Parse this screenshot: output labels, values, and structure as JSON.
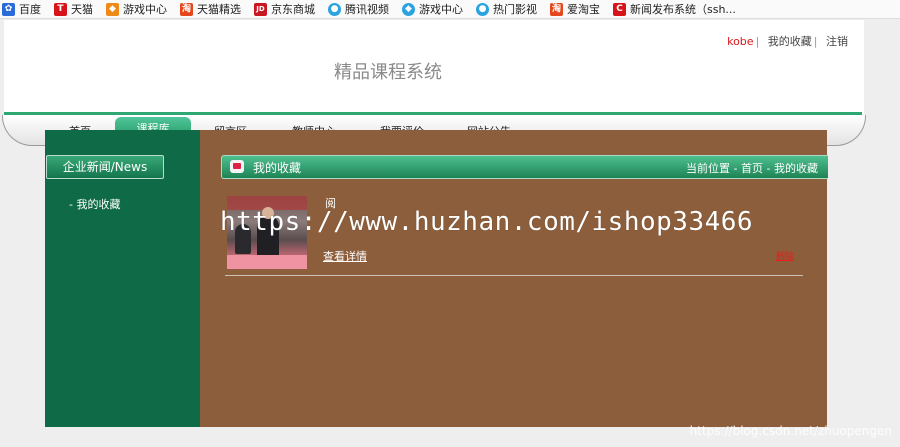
{
  "bookmarks": [
    {
      "label": "百度",
      "icon": "baidu-paw-icon",
      "color": "#2b6ad9"
    },
    {
      "label": "天猫",
      "icon": "tmall-icon",
      "color": "#d7141a"
    },
    {
      "label": "游戏中心",
      "icon": "game-center-icon",
      "color": "#ef8a17"
    },
    {
      "label": "天猫精选",
      "icon": "tmall-select-icon",
      "color": "#e5461c"
    },
    {
      "label": "京东商城",
      "icon": "jd-icon",
      "color": "#c81623"
    },
    {
      "label": "腾讯视频",
      "icon": "tencent-video-icon",
      "color": "#2aa3e0"
    },
    {
      "label": "游戏中心",
      "icon": "game-center-icon",
      "color": "#2aa3e0"
    },
    {
      "label": "热门影视",
      "icon": "hot-video-icon",
      "color": "#2aa3e0"
    },
    {
      "label": "爱淘宝",
      "icon": "ai-taobao-icon",
      "color": "#e5461c"
    },
    {
      "label": "新闻发布系统（ssh...",
      "icon": "csdn-icon",
      "color": "#d7141a"
    }
  ],
  "header": {
    "username": "kobe",
    "favorites_link": "我的收藏",
    "logout_link": "注销",
    "site_title": "精品课程系统"
  },
  "nav": [
    "首页",
    "课程库",
    "留言区",
    "教师中心",
    "我要评价",
    "网站公告"
  ],
  "nav_active": "课程库",
  "sidebar": {
    "heading": "企业新闻/News",
    "link": "- 我的收藏"
  },
  "content": {
    "section_title": "我的收藏",
    "breadcrumb_prefix": "当前位置 -",
    "breadcrumb_home": "首页",
    "breadcrumb_sep": "-",
    "breadcrumb_current": "我的收藏",
    "item_name": "阅",
    "details_link": "查看详情",
    "delete_link": "删除"
  },
  "watermarks": {
    "shop": "https://www.huzhan.com/ishop33466",
    "blog": "https://blog.csdn.net/zhuopengen"
  },
  "colors": {
    "brand_green": "#0f6b47",
    "content_brown": "#8c5e3b",
    "username_red": "#d8161b",
    "delete_red": "#e51e1e"
  }
}
